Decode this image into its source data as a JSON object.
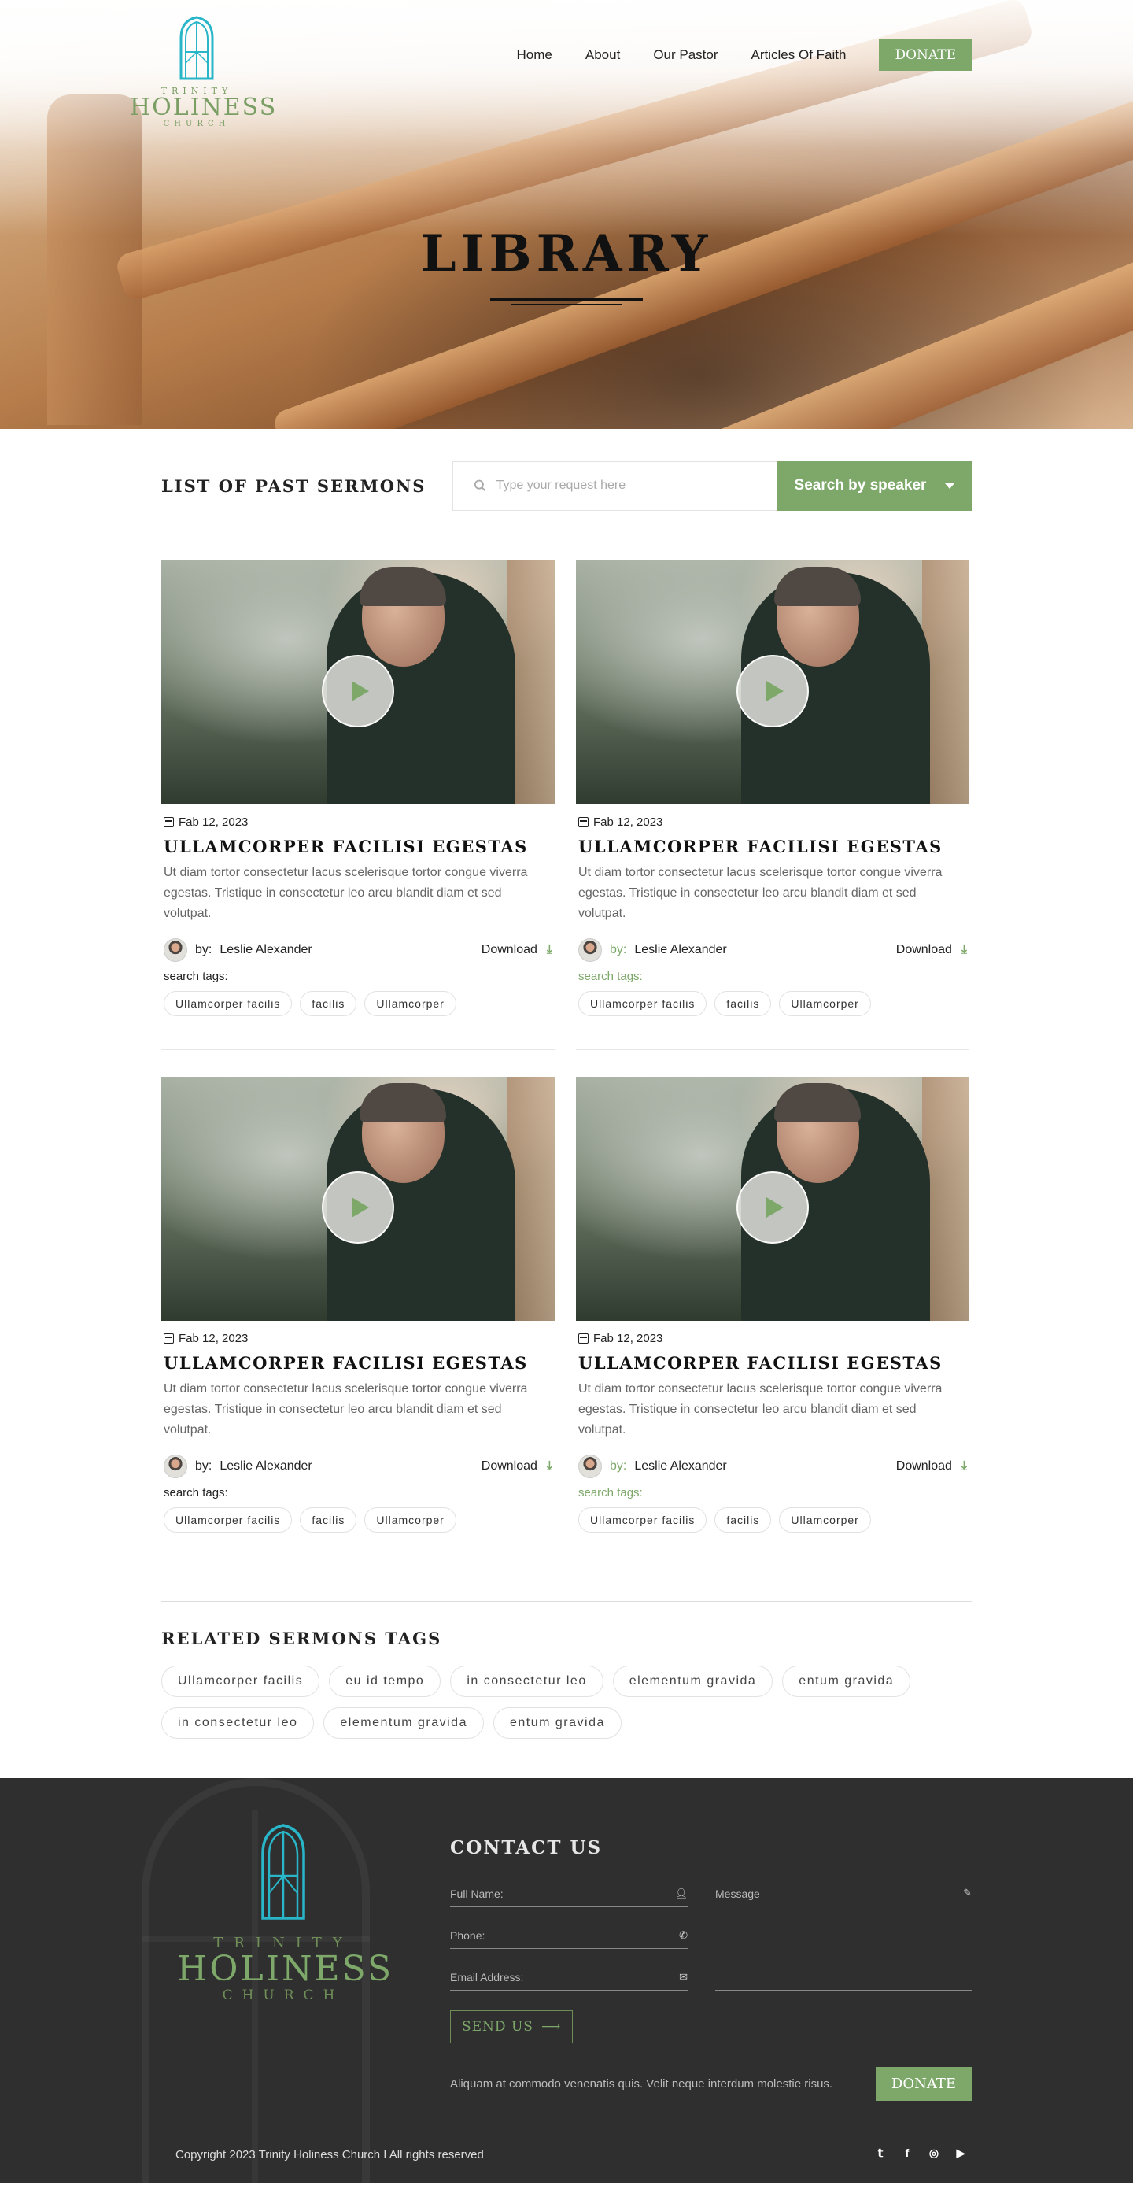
{
  "header": {
    "logo": {
      "trinity": "TRINITY",
      "holiness": "HOLINESS",
      "church": "CHURCH"
    },
    "nav": [
      "Home",
      "About",
      "Our Pastor",
      "Articles Of Faith"
    ],
    "donate_label": "DONATE"
  },
  "hero": {
    "title": "LIBRARY"
  },
  "list": {
    "title": "LIST OF PAST SERMONS",
    "search_placeholder": "Type your request here",
    "speaker_label": "Search by speaker"
  },
  "sermons": [
    {
      "date": "Fab 12, 2023",
      "title": "ULLAMCORPER FACILISI EGESTAS",
      "desc": "Ut diam tortor consectetur lacus scelerisque tortor congue viverra egestas. Tristique in consectetur leo arcu blandit diam et sed volutpat.",
      "by": "by:",
      "author": "Leslie Alexander",
      "download": "Download",
      "tags_label": "search tags:",
      "tags": [
        "Ullamcorper facilis",
        "facilis",
        "Ullamcorper"
      ]
    },
    {
      "date": "Fab 12, 2023",
      "title": "ULLAMCORPER FACILISI EGESTAS",
      "desc": "Ut diam tortor consectetur lacus scelerisque tortor congue viverra egestas. Tristique in consectetur leo arcu blandit diam et sed volutpat.",
      "by": "by:",
      "author": "Leslie Alexander",
      "download": "Download",
      "tags_label": "search tags:",
      "tags": [
        "Ullamcorper facilis",
        "facilis",
        "Ullamcorper"
      ]
    },
    {
      "date": "Fab 12, 2023",
      "title": "ULLAMCORPER FACILISI EGESTAS",
      "desc": "Ut diam tortor consectetur lacus scelerisque tortor congue viverra egestas. Tristique in consectetur leo arcu blandit diam et sed volutpat.",
      "by": "by:",
      "author": "Leslie Alexander",
      "download": "Download",
      "tags_label": "search tags:",
      "tags": [
        "Ullamcorper facilis",
        "facilis",
        "Ullamcorper"
      ]
    },
    {
      "date": "Fab 12, 2023",
      "title": "ULLAMCORPER FACILISI EGESTAS",
      "desc": "Ut diam tortor consectetur lacus scelerisque tortor congue viverra egestas. Tristique in consectetur leo arcu blandit diam et sed volutpat.",
      "by": "by:",
      "author": "Leslie Alexander",
      "download": "Download",
      "tags_label": "search tags:",
      "tags": [
        "Ullamcorper facilis",
        "facilis",
        "Ullamcorper"
      ]
    }
  ],
  "related": {
    "title": "RELATED SERMONS TAGS",
    "tags": [
      "Ullamcorper facilis",
      "eu id tempo",
      "in consectetur leo",
      "elementum gravida",
      "entum gravida",
      "in consectetur leo",
      "elementum gravida",
      "entum gravida"
    ]
  },
  "footer": {
    "logo": {
      "trinity": "TRINITY",
      "holiness": "HOLINESS",
      "church": "CHURCH"
    },
    "contact_title": "CONTACT US",
    "full_name": "Full Name:",
    "phone": "Phone:",
    "email": "Email Address:",
    "message": "Message",
    "send_label": "SEND US",
    "text": "Aliquam at commodo venenatis quis. Velit neque interdum molestie risus.",
    "donate_label": "DONATE",
    "copyright": "Copyright 2023 Trinity Holiness Church I All rights reserved",
    "social": [
      "twitter-icon",
      "facebook-icon",
      "instagram-icon",
      "youtube-icon"
    ]
  },
  "colors": {
    "accent": "#7da86a",
    "footer_bg": "#2f2f2f",
    "logo_blue": "#29b6c9"
  }
}
